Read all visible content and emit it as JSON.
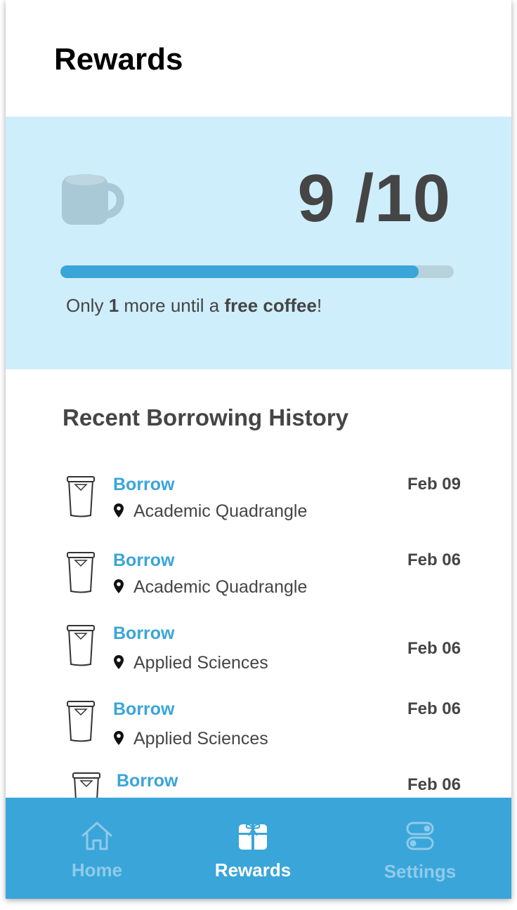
{
  "header": {
    "title": "Rewards"
  },
  "rewards": {
    "count": "9 /10",
    "progress_fraction": 0.91,
    "message": {
      "pre": "Only ",
      "number": "1",
      "mid": " more until a ",
      "highlight": "free coffee",
      "post": "!"
    },
    "colors": {
      "panel_bg": "#cfeefc",
      "bar_fill": "#3aa5d9",
      "bar_track": "#b8d2dc",
      "mug": "#aac9d6"
    }
  },
  "history": {
    "title": "Recent Borrowing History",
    "items": [
      {
        "action": "Borrow",
        "location": "Academic Quadrangle",
        "date": "Feb 09"
      },
      {
        "action": "Borrow",
        "location": "Academic Quadrangle",
        "date": "Feb 06"
      },
      {
        "action": "Borrow",
        "location": "Applied Sciences",
        "date": "Feb 06"
      },
      {
        "action": "Borrow",
        "location": "Applied Sciences",
        "date": "Feb 06"
      },
      {
        "action": "Borrow",
        "location": "",
        "date": "Feb 06"
      }
    ]
  },
  "nav": {
    "items": [
      {
        "label": "Home",
        "icon": "home-icon",
        "active": false
      },
      {
        "label": "Rewards",
        "icon": "gift-icon",
        "active": true
      },
      {
        "label": "Settings",
        "icon": "toggle-icon",
        "active": false
      }
    ],
    "colors": {
      "bar_bg": "#3aa5d9",
      "active": "#ffffff",
      "inactive": "#8fcbe9"
    }
  }
}
